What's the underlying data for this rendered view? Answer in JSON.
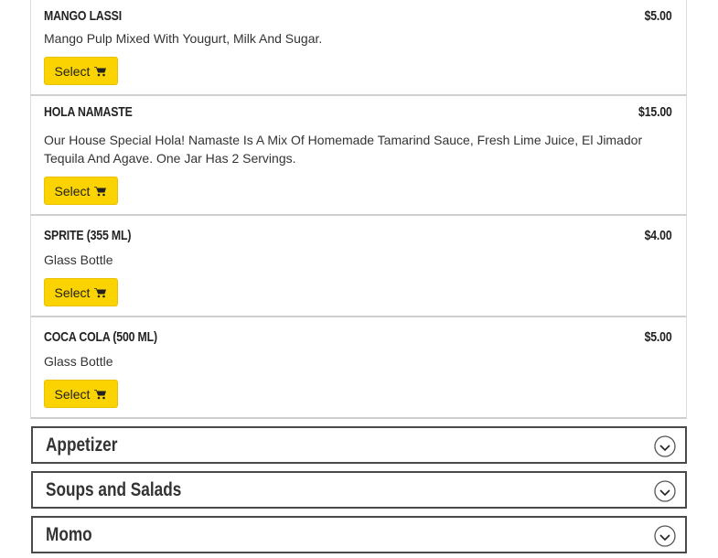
{
  "menu_items": [
    {
      "name": "Mango Lassi",
      "price": "$5.00",
      "description": "Mango Pulp Mixed With Yougurt, Milk And Sugar.",
      "select_label": "Select"
    },
    {
      "name": "Hola Namaste",
      "price": "$15.00",
      "description": "Our House Special Hola! Namaste Is A Mix Of Homemade Tamarind Sauce, Fresh Lime Juice, El Jimador Tequila And Agave. One Jar Has 2 Servings.",
      "select_label": "Select"
    },
    {
      "name": "Sprite (355 ml)",
      "price": "$4.00",
      "description": "Glass Bottle",
      "select_label": "Select"
    },
    {
      "name": "Coca Cola (500 ml)",
      "price": "$5.00",
      "description": "Glass Bottle",
      "select_label": "Select"
    }
  ],
  "categories": [
    {
      "label": "Appetizer",
      "icon": "chevron-down-icon"
    },
    {
      "label": "Soups and Salads",
      "icon": "chevron-down-icon"
    },
    {
      "label": "Momo",
      "icon": "chevron-down-icon"
    }
  ],
  "colors": {
    "accent": "#fbd300",
    "border": "#4a4a4a"
  }
}
